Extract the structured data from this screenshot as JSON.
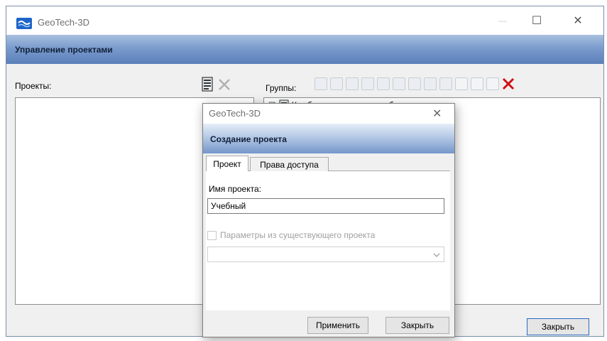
{
  "window": {
    "title": "GeoTech-3D",
    "header": "Управление проектами",
    "controls": {
      "minimize": "—",
      "maximize": "☐",
      "close": "✕"
    }
  },
  "projects": {
    "label": "Проекты:",
    "toolbar": [
      {
        "icon": "new-document-icon",
        "enabled": true
      },
      {
        "icon": "delete-x-icon",
        "enabled": false
      }
    ]
  },
  "groups": {
    "label": "Группы:",
    "tree": [
      {
        "expander": "⊟",
        "label": "Комбинированная разработка"
      }
    ],
    "toolbar_count": 13,
    "delete_icon": "delete-x-icon"
  },
  "main_close_label": "Закрыть",
  "dialog": {
    "title": "GeoTech-3D",
    "header": "Создание проекта",
    "close_glyph": "✕",
    "tabs": [
      {
        "label": "Проект",
        "active": true
      },
      {
        "label": "Права доступа",
        "active": false
      }
    ],
    "name_label": "Имя проекта:",
    "name_value": "Учебный",
    "params_label": "Параметры из существующего проекта",
    "params_checked": false,
    "params_select_value": "",
    "apply_label": "Применить",
    "close_label": "Закрыть"
  },
  "colors": {
    "header_band": "#5b7fb9",
    "delete_red": "#d01010",
    "focus_border": "#2b6cc4"
  }
}
